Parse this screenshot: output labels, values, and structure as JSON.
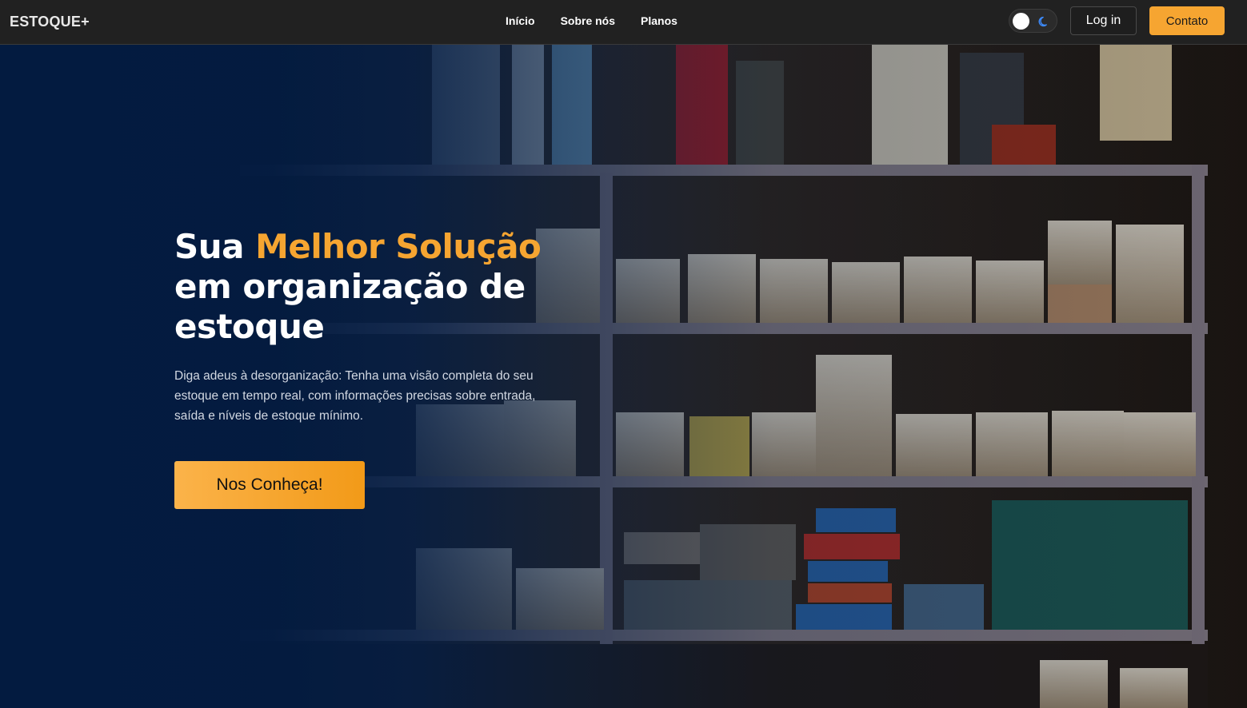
{
  "navbar": {
    "brand": "ESTOQUE+",
    "links": [
      "Início",
      "Sobre nós",
      "Planos"
    ],
    "theme_toggle": {
      "icon": "moon-icon",
      "state": "dark"
    },
    "login_label": "Log in",
    "contact_label": "Contato"
  },
  "hero": {
    "title_part1": "Sua ",
    "title_highlight": "Melhor Solução",
    "title_part2": "em organização de estoque",
    "description": "Diga adeus à desorganização: Tenha uma visão completa do seu estoque em tempo real, com informações precisas sobre entrada, saída e níveis de estoque mínimo.",
    "cta_label": "Nos Conheça!",
    "background": "shelves-photo"
  },
  "colors": {
    "accent": "#f6a531",
    "navbar_bg": "#212121",
    "hero_overlay": "#031b40"
  }
}
